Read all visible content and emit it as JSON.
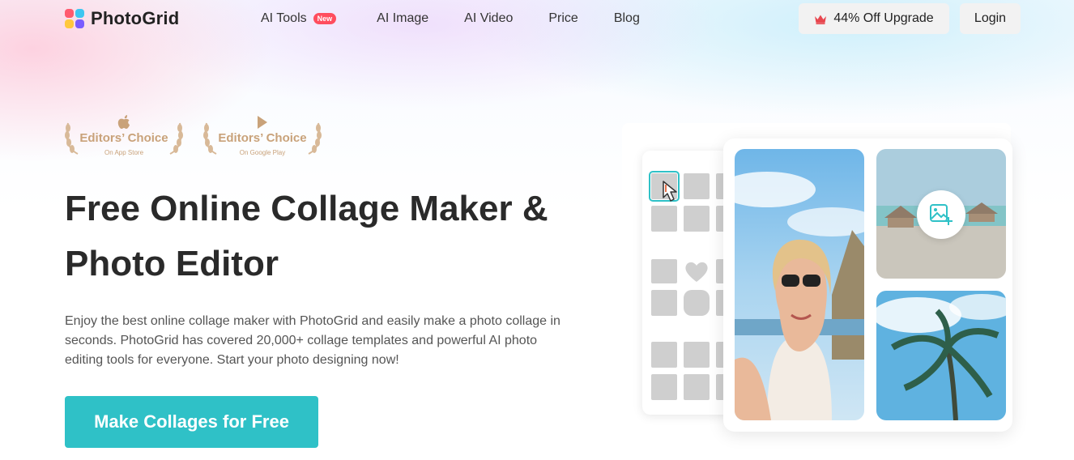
{
  "header": {
    "brand": "PhotoGrid",
    "nav": [
      {
        "label": "AI Tools",
        "badge": "New"
      },
      {
        "label": "AI Image"
      },
      {
        "label": "AI Video"
      },
      {
        "label": "Price"
      },
      {
        "label": "Blog"
      }
    ],
    "upgrade_label": "44% Off Upgrade",
    "login_label": "Login"
  },
  "awards": [
    {
      "title": "Editors’ Choice",
      "subtitle": "On App Store",
      "icon": "apple-icon"
    },
    {
      "title": "Editors’ Choice",
      "subtitle": "On Google Play",
      "icon": "google-play-icon"
    }
  ],
  "hero": {
    "title_line1": "Free Online Collage Maker &",
    "title_line2": "Photo Editor",
    "description": "Enjoy the best online collage maker with PhotoGrid and easily make a photo collage in seconds. PhotoGrid has covered 20,000+ collage templates and powerful AI photo editing tools for everyone. Start your photo designing now!",
    "cta_label": "Make Collages for Free"
  },
  "colors": {
    "accent": "#2fc1c7",
    "badge": "#ff4d5e",
    "award_gold": "#c9a27a",
    "crown": "#e8474f"
  }
}
